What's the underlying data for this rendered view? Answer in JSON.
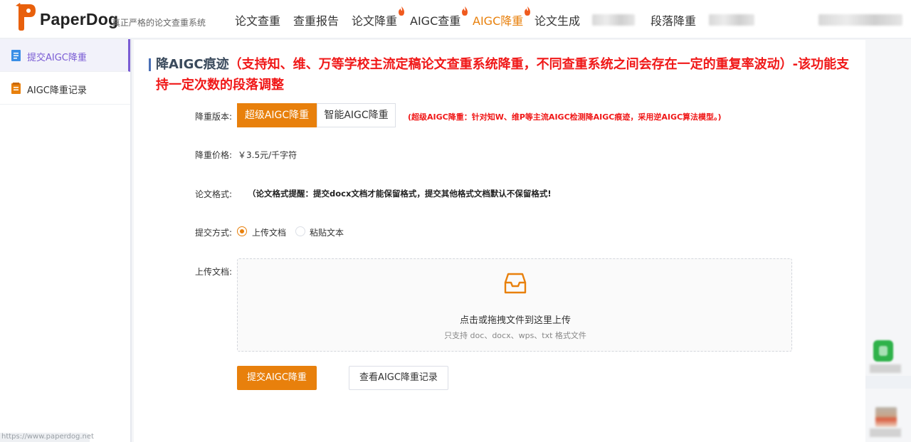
{
  "header": {
    "brand": "PaperDog",
    "slogan": "真正严格的论文查重系统",
    "nav": [
      {
        "label": "论文查重",
        "hot": false,
        "active": false
      },
      {
        "label": "查重报告",
        "hot": false,
        "active": false
      },
      {
        "label": "论文降重",
        "hot": true,
        "active": false
      },
      {
        "label": "AIGC查重",
        "hot": true,
        "active": false
      },
      {
        "label": "AIGC降重",
        "hot": true,
        "active": true
      },
      {
        "label": "论文生成",
        "hot": false,
        "active": false
      },
      {
        "label": "段落降重",
        "hot": false,
        "active": false
      }
    ],
    "hot_icon": "flame-icon"
  },
  "sidebar": {
    "items": [
      {
        "label": "提交AIGC降重",
        "icon": "document-icon",
        "active": true
      },
      {
        "label": "AIGC降重记录",
        "icon": "record-book-icon",
        "active": false
      }
    ],
    "url_hint": "https://www.paperdog.net"
  },
  "main": {
    "title": "降AIGC痕迹",
    "title_note": "（支持知、维、万等学校主流定稿论文查重系统降重，不同查重系统之间会存在一定的重复率波动）-该功能支持一定次数的段落调整",
    "version_label": "降重版本:",
    "versions": [
      {
        "label": "超级AIGC降重",
        "selected": true
      },
      {
        "label": "智能AIGC降重",
        "selected": false
      }
    ],
    "version_note": "(超级AIGC降重：针对知W、维P等主流AIGC检测降AIGC痕迹，采用逆AIGC算法模型。)",
    "price_label": "降重价格:",
    "price": "￥3.5元/千字符",
    "format_label": "论文格式:",
    "format_note": "（论文格式提醒：提交docx文档才能保留格式，提交其他格式文档默认不保留格式!",
    "submit_method_label": "提交方式:",
    "submit_methods": [
      {
        "label": "上传文档",
        "selected": true
      },
      {
        "label": "粘贴文本",
        "selected": false
      }
    ],
    "upload_label": "上传文档:",
    "upload": {
      "icon": "inbox-icon",
      "text": "点击或拖拽文件到这里上传",
      "hint": "只支持 doc、docx、wps、txt 格式文件"
    },
    "submit_button": "提交AIGC降重",
    "records_button": "查看AIGC降重记录"
  },
  "colors": {
    "accent": "#e8800c",
    "warning_red": "#f01818",
    "sidebar_active": "#7a5cd4",
    "title_bar": "#4a6fb5"
  }
}
